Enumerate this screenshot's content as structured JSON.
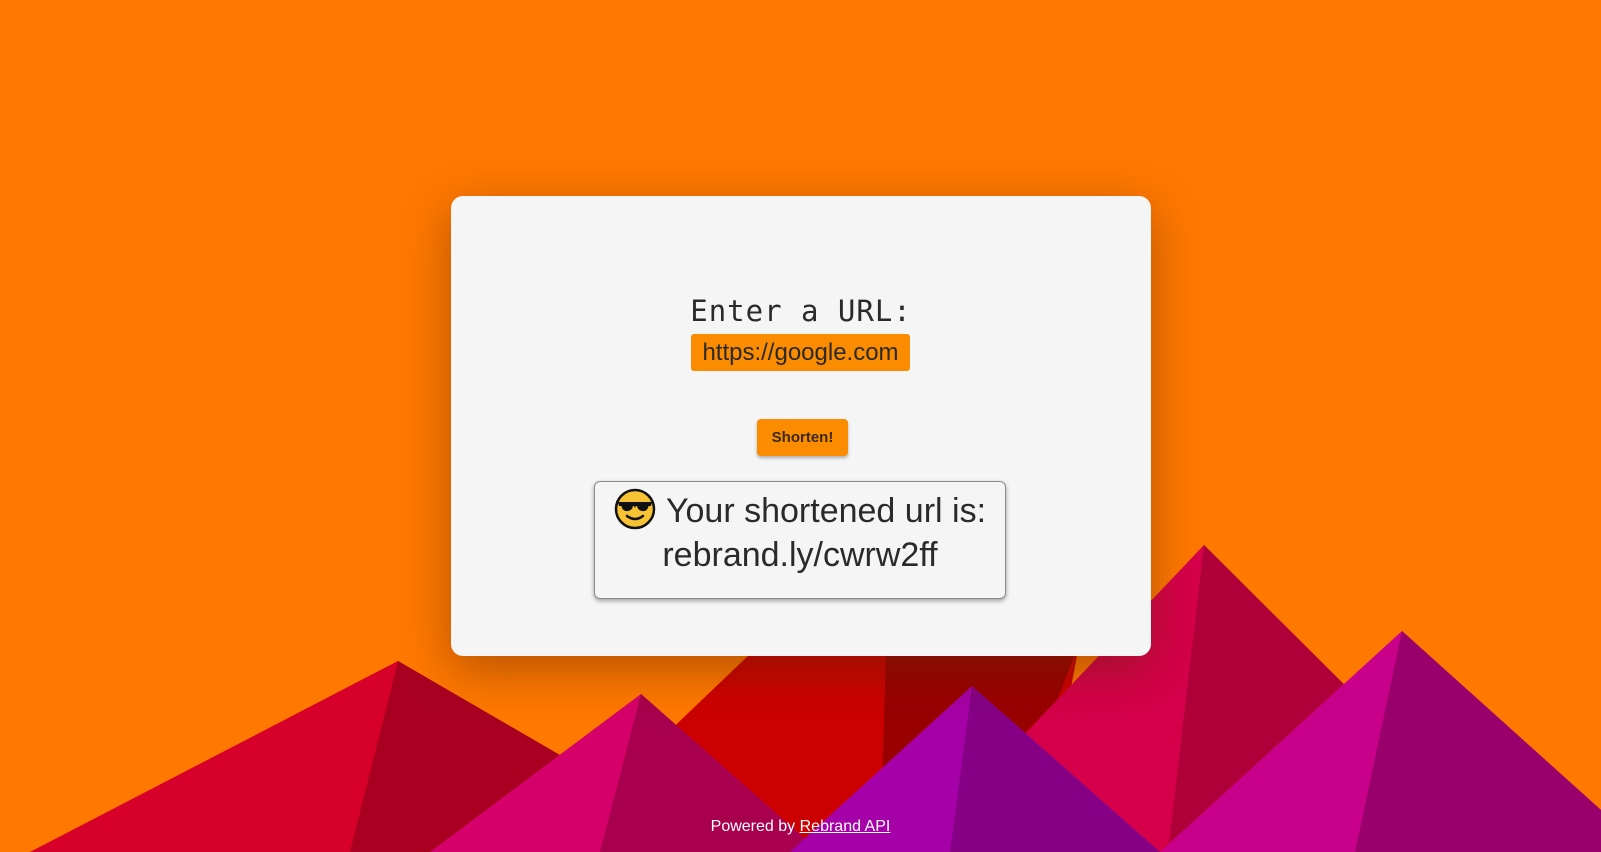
{
  "form": {
    "prompt_label": "Enter a URL:",
    "url_value": "https://google.com",
    "shorten_label": "Shorten!"
  },
  "result": {
    "emoji_icon": "cool-sunglasses-face-icon",
    "label": "Your shortened url is:",
    "short_url": "rebrand.ly/cwrw2ff"
  },
  "footer": {
    "powered_by": "Powered by",
    "link_text": "Rebrand API"
  },
  "colors": {
    "background": "#ff7800",
    "accent": "#fb8c00",
    "card": "#f5f5f5"
  }
}
